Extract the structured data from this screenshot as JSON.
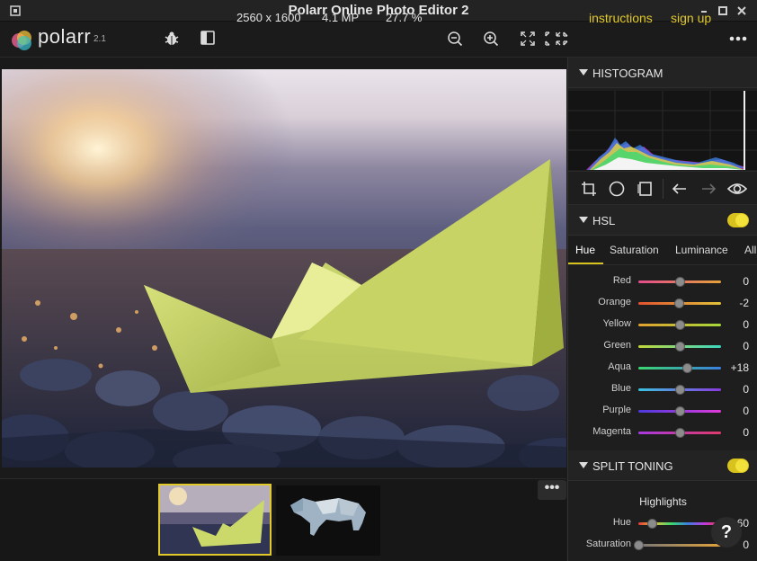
{
  "window": {
    "title": "Polarr Online Photo Editor 2",
    "icon": "app-square-icon",
    "controls": [
      "minimize-icon",
      "maximize-icon",
      "close-icon"
    ]
  },
  "toolbar": {
    "logo_text": "polarr",
    "logo_version": "2.1",
    "resolution": "2560 x 1600",
    "megapixels": "4.1 MP",
    "zoom": "27.7 %",
    "instructions_label": "instructions",
    "signup_label": "sign up",
    "icons": [
      "bug-icon",
      "sidebar-toggle-icon",
      "zoom-out-icon",
      "zoom-in-icon",
      "fit-screen-icon",
      "fullscreen-icon",
      "more-icon"
    ]
  },
  "filmstrip": {
    "more_label": "•••",
    "thumbnails": [
      "paper-boat-thumbnail",
      "polar-bear-thumbnail"
    ],
    "selected_index": 0
  },
  "panel": {
    "histogram": {
      "title": "HISTOGRAM"
    },
    "tools": [
      "crop-icon",
      "circle-mask-icon",
      "rect-mask-icon",
      "undo-icon",
      "redo-icon",
      "eye-icon"
    ],
    "hsl": {
      "title": "HSL",
      "enabled": true,
      "tabs": [
        "Hue",
        "Saturation",
        "Luminance",
        "All"
      ],
      "active_tab": "Hue",
      "sliders": [
        {
          "label": "Red",
          "value": "0",
          "pos": 0.5
        },
        {
          "label": "Orange",
          "value": "-2",
          "pos": 0.49
        },
        {
          "label": "Yellow",
          "value": "0",
          "pos": 0.5
        },
        {
          "label": "Green",
          "value": "0",
          "pos": 0.5
        },
        {
          "label": "Aqua",
          "value": "+18",
          "pos": 0.59
        },
        {
          "label": "Blue",
          "value": "0",
          "pos": 0.5
        },
        {
          "label": "Purple",
          "value": "0",
          "pos": 0.5
        },
        {
          "label": "Magenta",
          "value": "0",
          "pos": 0.5
        }
      ]
    },
    "split_toning": {
      "title": "SPLIT TONING",
      "enabled": true,
      "highlights_label": "Highlights",
      "sliders": [
        {
          "label": "Hue",
          "value": "60",
          "pos": 0.17
        },
        {
          "label": "Saturation",
          "value": "0",
          "pos": 0.0
        }
      ]
    },
    "help_label": "?"
  },
  "colors": {
    "accent": "#d8c21e",
    "link": "#e2c92a"
  }
}
